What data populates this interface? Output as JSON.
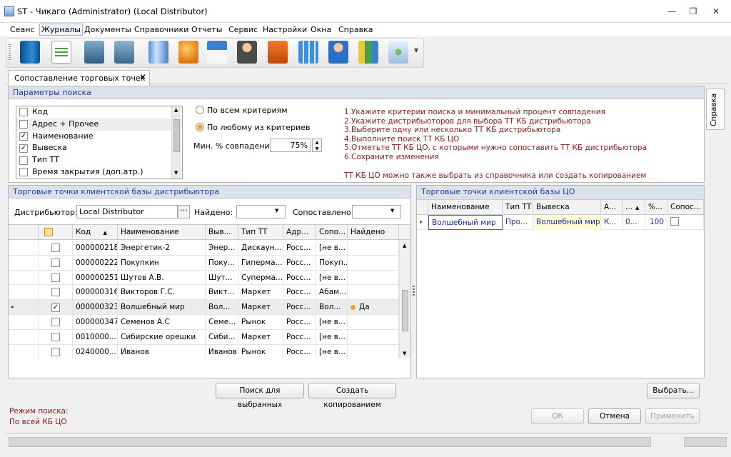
{
  "window": {
    "title": "ST - Чикаго (Administrator) (Local Distributor)"
  },
  "menu": [
    "Сеанс",
    "Журналы",
    "Документы",
    "Справочники",
    "Отчеты",
    "Сервис",
    "Настройки",
    "Окна",
    "Справка"
  ],
  "toolbar": {
    "icons": [
      "book-icon",
      "checklist-icon",
      "export-icon",
      "import-icon",
      "truck-icon",
      "users-icon",
      "house-icon",
      "manager-icon",
      "box-icon",
      "calculator-icon",
      "person-icon",
      "bar-chart-icon",
      "settings-icon"
    ]
  },
  "tab": {
    "label": "Сопоставление торговых точек"
  },
  "side_tab": "Справка",
  "search": {
    "header": "Параметры поиска",
    "criteria": [
      {
        "label": "Код",
        "checked": false
      },
      {
        "label": "Адрес + Прочее",
        "checked": false
      },
      {
        "label": "Наименование",
        "checked": true
      },
      {
        "label": "Вывеска",
        "checked": true
      },
      {
        "label": "Тип ТТ",
        "checked": false
      },
      {
        "label": "Время закрытия (доп.атр.)",
        "checked": false
      }
    ],
    "radio_all": "По всем критериям",
    "radio_any": "По любому из критериев",
    "min_match_label": "Мин. % совпадения:",
    "min_match_value": "75%",
    "instructions": [
      "1.Укажите критерии поиска и минимальный процент совпадения",
      "2.Укажите дистрибьюторов для выбора ТТ КБ дистрибьютора",
      "3.Выберите одну или несколько ТТ КБ дистрибьютора",
      "4.Выполните поиск ТТ КБ ЦО",
      "5.Отметьте ТТ КБ ЦО, с которыми нужно сопоставить ТТ КБ дистрибьютора",
      "6.Сохраните изменения"
    ],
    "note": "ТТ КБ ЦО можно также выбрать из справочника или создать копированием"
  },
  "left": {
    "header": "Торговые точки клиентской базы дистрибьютора",
    "distributor_label": "Дистрибьютор:",
    "distributor_value": "Local Distributor",
    "found_label": "Найдено:",
    "matched_label": "Сопоставлено:",
    "columns": [
      "Код",
      "Наименование",
      "Вывеска",
      "Тип ТТ",
      "Адрес",
      "Сопоставлено",
      "Найдено"
    ],
    "columns_shown": [
      "Код",
      "Наименование",
      "Выв...",
      "Тип ТТ",
      "Адр...",
      "Сопо...",
      "Найдено"
    ],
    "rows": [
      {
        "code": "000000218",
        "name": "Энергетик-2",
        "sign": "Энер...",
        "type": "Дискаун...",
        "addr": "Росс...",
        "match": "[не в...",
        "found": "",
        "checked": false,
        "current": false
      },
      {
        "code": "000000222",
        "name": "Покупкин",
        "sign": "Поку...",
        "type": "Гиперма...",
        "addr": "Росс...",
        "match": "Покуп...",
        "found": "",
        "checked": false,
        "current": false
      },
      {
        "code": "000000251",
        "name": "Шутов А.В.",
        "sign": "Шут...",
        "type": "Суперма...",
        "addr": "Росс...",
        "match": "[не в...",
        "found": "",
        "checked": false,
        "current": false
      },
      {
        "code": "000000316",
        "name": "Викторов Г.С.",
        "sign": "Викт...",
        "type": "Маркет",
        "addr": "Росс...",
        "match": "Абам...",
        "found": "",
        "checked": false,
        "current": false
      },
      {
        "code": "000000323",
        "name": "Волшебный мир",
        "sign": "Вол...",
        "type": "Маркет",
        "addr": "Росс...",
        "match": "Вол...",
        "found": "Да",
        "checked": true,
        "current": true
      },
      {
        "code": "000000347",
        "name": "Семенов А.С",
        "sign": "Семе...",
        "type": "Рынок",
        "addr": "Росс...",
        "match": "[не в...",
        "found": "",
        "checked": false,
        "current": false
      },
      {
        "code": "0010000...",
        "name": "Сибирские орешки",
        "sign": "Сиби...",
        "type": "Маркет",
        "addr": "Росс...",
        "match": "[не в...",
        "found": "",
        "checked": false,
        "current": false
      },
      {
        "code": "0240000...",
        "name": "Иванов",
        "sign": "Иванов",
        "type": "Рынок",
        "addr": "Росс...",
        "match": "[не в...",
        "found": "",
        "checked": false,
        "current": false
      }
    ],
    "btn_search": "Поиск для выбранных",
    "btn_copy": "Создать копированием"
  },
  "right": {
    "header": "Торговые точки клиентской базы ЦО",
    "columns_shown": [
      "Наименование",
      "Тип ТТ",
      "Вывеска",
      "А...",
      "...",
      "%...",
      "Сопос..."
    ],
    "rows": [
      {
        "name": "Волшебный мир",
        "type": "Про...",
        "sign": "Волшебный мир",
        "a": "К...",
        "b": "0...",
        "pct": "100",
        "checked": false
      }
    ],
    "btn_select": "Выбрать..."
  },
  "status": {
    "mode_label": "Режим поиска:",
    "mode_value": "По всей КБ ЦО"
  },
  "footer": {
    "ok": "ОК",
    "cancel": "Отмена",
    "apply": "Применить"
  }
}
